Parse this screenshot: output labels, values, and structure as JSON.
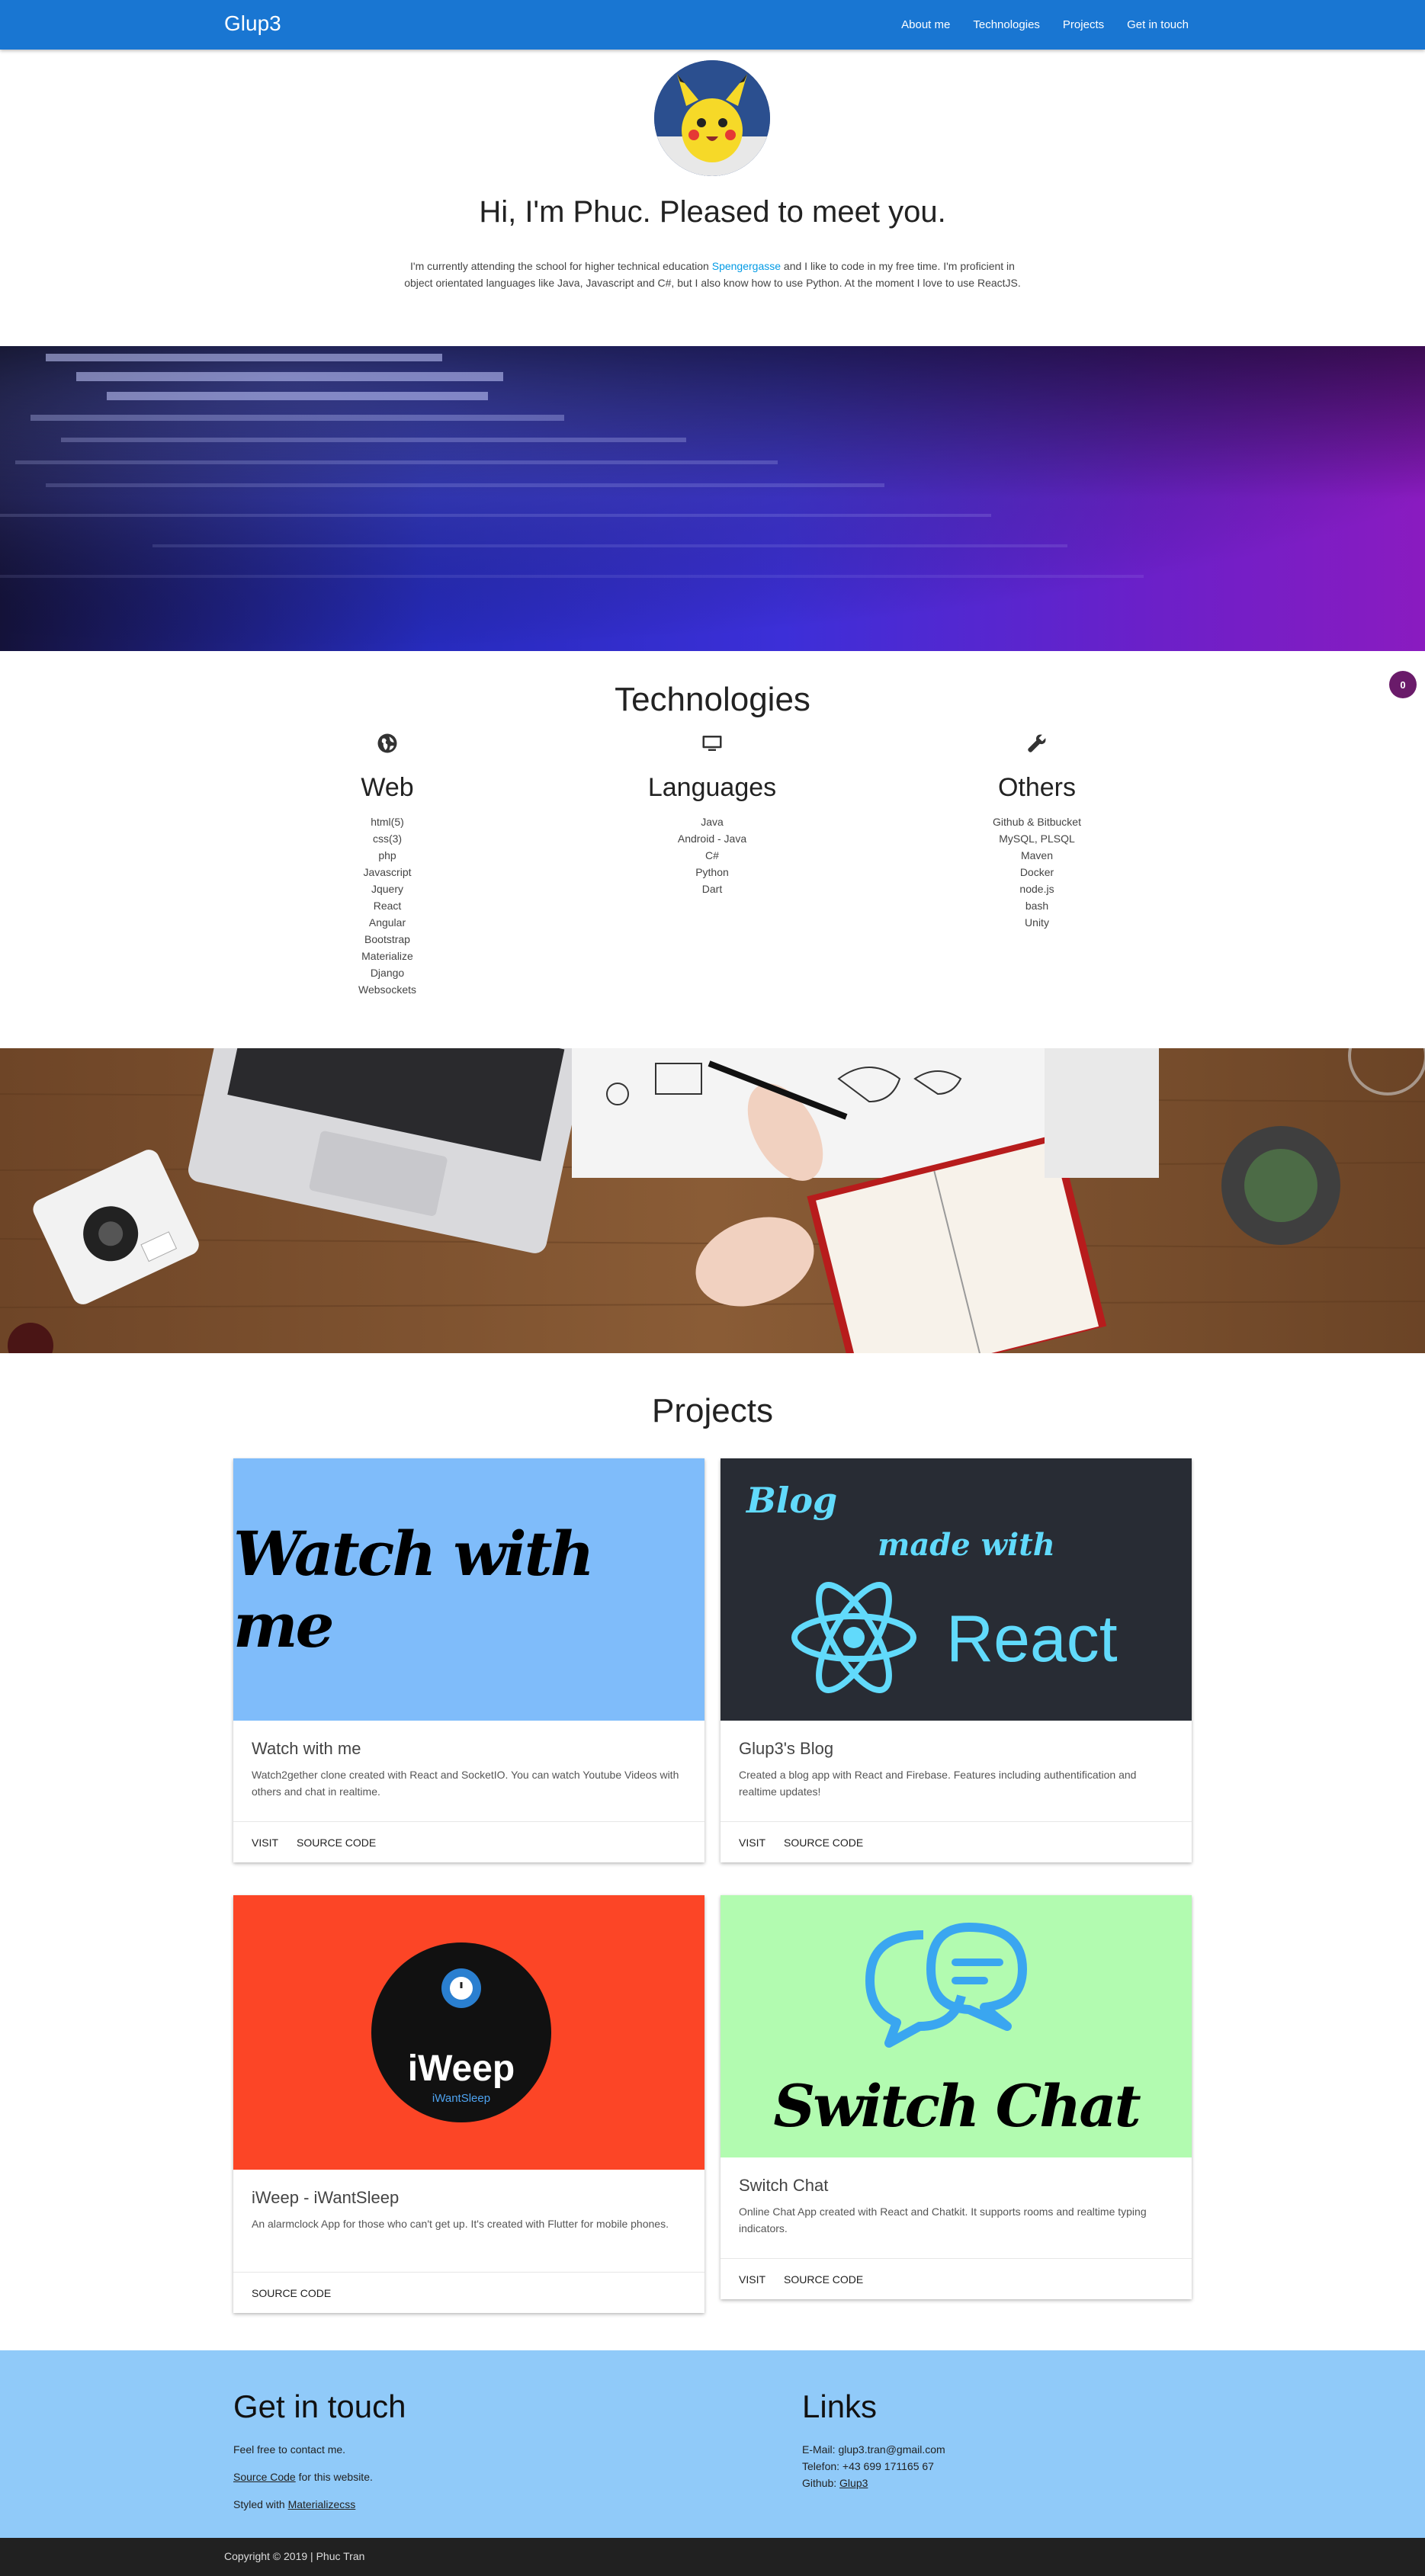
{
  "navbar": {
    "brand": "Glup3",
    "links": [
      "About me",
      "Technologies",
      "Projects",
      "Get in touch"
    ]
  },
  "hero": {
    "title": "Hi, I'm Phuc. Pleased to meet you.",
    "text_before_link": "I'm currently attending the school for higher technical education ",
    "link": "Spengergasse",
    "text_after_link": " and I like to code in my free time. I'm proficient in object orientated languages like Java, Javascript and C#, but I also know how to use Python. At the moment I love to use ReactJS."
  },
  "badge": {
    "count": "0"
  },
  "technologies": {
    "title": "Technologies",
    "columns": [
      {
        "icon": "globe-icon",
        "title": "Web",
        "items": [
          "html(5)",
          "css(3)",
          "php",
          "Javascript",
          "Jquery",
          "React",
          "Angular",
          "Bootstrap",
          "Materialize",
          "Django",
          "Websockets"
        ]
      },
      {
        "icon": "monitor-icon",
        "title": "Languages",
        "items": [
          "Java",
          "Android - Java",
          "C#",
          "Python",
          "Dart"
        ]
      },
      {
        "icon": "wrench-icon",
        "title": "Others",
        "items": [
          "Github & Bitbucket",
          "MySQL, PLSQL",
          "Maven",
          "Docker",
          "node.js",
          "bash",
          "Unity"
        ]
      }
    ]
  },
  "projects": {
    "title": "Projects",
    "cards": [
      {
        "image_text": "Watch with me",
        "image_bg": "#7fbcfa",
        "title": "Watch with me",
        "desc": "Watch2gether clone created with React and SocketIO. You can watch Youtube Videos with others and chat in realtime.",
        "actions": [
          "VISIT",
          "SOURCE CODE"
        ]
      },
      {
        "image_text_1": "Blog",
        "image_text_2": "made with",
        "image_text_3": "React",
        "image_bg": "#282c34",
        "title": "Glup3's Blog",
        "desc": "Created a blog app with React and Firebase. Features including authentification and realtime updates!",
        "actions": [
          "VISIT",
          "SOURCE CODE"
        ]
      },
      {
        "image_text_1": "iWeep",
        "image_text_2": "iWantSleep",
        "image_bg": "#fc4526",
        "title": "iWeep - iWantSleep",
        "desc": "An alarmclock App for those who can't get up. It's created with Flutter for mobile phones.",
        "actions": [
          "SOURCE CODE"
        ]
      },
      {
        "image_text": "Switch Chat",
        "image_bg": "#b2fbb0",
        "title": "Switch Chat",
        "desc": "Online Chat App created with React and Chatkit. It supports rooms and realtime typing indicators.",
        "actions": [
          "VISIT",
          "SOURCE CODE"
        ]
      }
    ]
  },
  "footer": {
    "contact_title": "Get in touch",
    "contact_line": "Feel free to contact me.",
    "source_link": "Source Code",
    "source_suffix": " for this website.",
    "styled_prefix": "Styled with ",
    "styled_link": "Materializecss",
    "links_title": "Links",
    "email": "E-Mail: glup3.tran@gmail.com",
    "phone": "Telefon: +43 699 171165 67",
    "github_prefix": "Github: ",
    "github_link": "Glup3",
    "copyright": "Copyright © 2019 | Phuc Tran"
  },
  "colors": {
    "navbar": "#1976d2",
    "footer": "#90caf9",
    "link": "#039be5",
    "badge": "#6a1b6a",
    "copyright_bar": "#212121"
  }
}
